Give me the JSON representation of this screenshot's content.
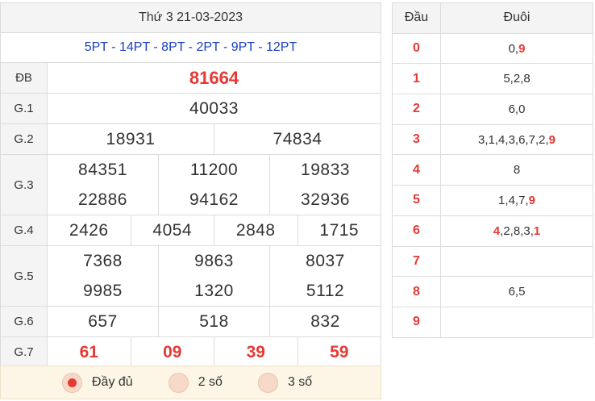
{
  "header": {
    "date": "Thứ 3 21-03-2023",
    "pt_codes": "5PT - 14PT - 8PT - 2PT - 9PT - 12PT"
  },
  "prizes": {
    "db": {
      "label": "ĐB",
      "values": [
        "81664"
      ]
    },
    "g1": {
      "label": "G.1",
      "values": [
        "40033"
      ]
    },
    "g2": {
      "label": "G.2",
      "values": [
        "18931",
        "74834"
      ]
    },
    "g3": {
      "label": "G.3",
      "values": [
        "84351",
        "11200",
        "19833",
        "22886",
        "94162",
        "32936"
      ]
    },
    "g4": {
      "label": "G.4",
      "values": [
        "2426",
        "4054",
        "2848",
        "1715"
      ]
    },
    "g5": {
      "label": "G.5",
      "values": [
        "7368",
        "9863",
        "8037",
        "9985",
        "1320",
        "5112"
      ]
    },
    "g6": {
      "label": "G.6",
      "values": [
        "657",
        "518",
        "832"
      ]
    },
    "g7": {
      "label": "G.7",
      "values": [
        "61",
        "09",
        "39",
        "59"
      ]
    }
  },
  "options": [
    {
      "label": "Đầy đủ",
      "checked": true
    },
    {
      "label": "2 số",
      "checked": false
    },
    {
      "label": "3 số",
      "checked": false
    }
  ],
  "loto": {
    "col_head": "Đầu",
    "col_tail": "Đuôi",
    "rows": [
      {
        "head": "0",
        "tails": [
          {
            "d": "0",
            "hl": false
          },
          {
            "d": "9",
            "hl": true
          }
        ]
      },
      {
        "head": "1",
        "tails": [
          {
            "d": "5",
            "hl": false
          },
          {
            "d": "2",
            "hl": false
          },
          {
            "d": "8",
            "hl": false
          }
        ]
      },
      {
        "head": "2",
        "tails": [
          {
            "d": "6",
            "hl": false
          },
          {
            "d": "0",
            "hl": false
          }
        ]
      },
      {
        "head": "3",
        "tails": [
          {
            "d": "3",
            "hl": false
          },
          {
            "d": "1",
            "hl": false
          },
          {
            "d": "4",
            "hl": false
          },
          {
            "d": "3",
            "hl": false
          },
          {
            "d": "6",
            "hl": false
          },
          {
            "d": "7",
            "hl": false
          },
          {
            "d": "2",
            "hl": false
          },
          {
            "d": "9",
            "hl": true
          }
        ]
      },
      {
        "head": "4",
        "tails": [
          {
            "d": "8",
            "hl": false
          }
        ]
      },
      {
        "head": "5",
        "tails": [
          {
            "d": "1",
            "hl": false
          },
          {
            "d": "4",
            "hl": false
          },
          {
            "d": "7",
            "hl": false
          },
          {
            "d": "9",
            "hl": true
          }
        ]
      },
      {
        "head": "6",
        "tails": [
          {
            "d": "4",
            "hl": true
          },
          {
            "d": "2",
            "hl": false
          },
          {
            "d": "8",
            "hl": false
          },
          {
            "d": "3",
            "hl": false
          },
          {
            "d": "1",
            "hl": true
          }
        ]
      },
      {
        "head": "7",
        "tails": []
      },
      {
        "head": "8",
        "tails": [
          {
            "d": "6",
            "hl": false
          },
          {
            "d": "5",
            "hl": false
          }
        ]
      },
      {
        "head": "9",
        "tails": []
      }
    ]
  },
  "colors": {
    "accent_red": "#e53935",
    "pt_blue": "#1a3fc4",
    "option_bg": "#fdf6e6"
  }
}
